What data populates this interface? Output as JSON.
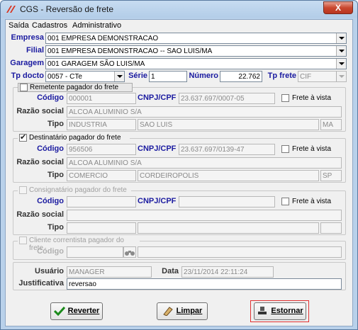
{
  "window": {
    "title": "CGS - Reversão de frete",
    "close_label": "X"
  },
  "menu": [
    "Saída",
    "Cadastros",
    "Administrativo"
  ],
  "header": {
    "empresa_label": "Empresa",
    "empresa_value": "001 EMPRESA DEMONSTRACAO",
    "filial_label": "Filial",
    "filial_value": "001 EMPRESA DEMONSTRACAO -- SAO LUIS/MA",
    "garagem_label": "Garagem",
    "garagem_value": "001 GARAGEM SÃO LUIS/MA",
    "tpdocto_label": "Tp docto",
    "tpdocto_value": "0057 - CTe",
    "serie_label": "Série",
    "serie_value": "1",
    "numero_label": "Número",
    "numero_value": "22.762",
    "tpfrete_label": "Tp frete",
    "tpfrete_value": "CIF"
  },
  "remetente": {
    "title": "Remetente pagador do frete",
    "checked": false,
    "codigo_label": "Código",
    "codigo_value": "000001",
    "cnpj_label": "CNPJ/CPF",
    "cnpj_value": "23.637.697/0007-05",
    "frete_vista_label": "Frete à vista",
    "razao_label": "Razão social",
    "razao_value": "ALCOA ALUMINIO S/A",
    "tipo_label": "Tipo",
    "tipo_value": "INDUSTRIA",
    "cidade_value": "SAO LUIS",
    "uf_value": "MA"
  },
  "destinatario": {
    "title": "Destinatário pagador do frete",
    "checked": true,
    "codigo_label": "Código",
    "codigo_value": "956506",
    "cnpj_label": "CNPJ/CPF",
    "cnpj_value": "23.637.697/0139-47",
    "frete_vista_label": "Frete à vista",
    "razao_label": "Razão social",
    "razao_value": "ALCOA ALUMINIO S/A",
    "tipo_label": "Tipo",
    "tipo_value": "COMERCIO",
    "cidade_value": "CORDEIROPOLIS",
    "uf_value": "SP"
  },
  "consignatario": {
    "title": "Consignatário pagador do frete",
    "codigo_label": "Código",
    "cnpj_label": "CNPJ/CPF",
    "frete_vista_label": "Frete à vista",
    "razao_label": "Razão social",
    "tipo_label": "Tipo"
  },
  "correntista": {
    "title": "Cliente correntista pagador do frete",
    "codigo_label": "Código"
  },
  "footer": {
    "usuario_label": "Usuário",
    "usuario_value": "MANAGER",
    "data_label": "Data",
    "data_value": "23/11/2014 22:11:24",
    "justificativa_label": "Justificativa",
    "justificativa_value": "reversao"
  },
  "buttons": {
    "reverter": "Reverter",
    "limpar": "Limpar",
    "estornar": "Estornar"
  },
  "colors": {
    "label_blue": "#1a1aa0",
    "highlight_red": "#e03030"
  }
}
